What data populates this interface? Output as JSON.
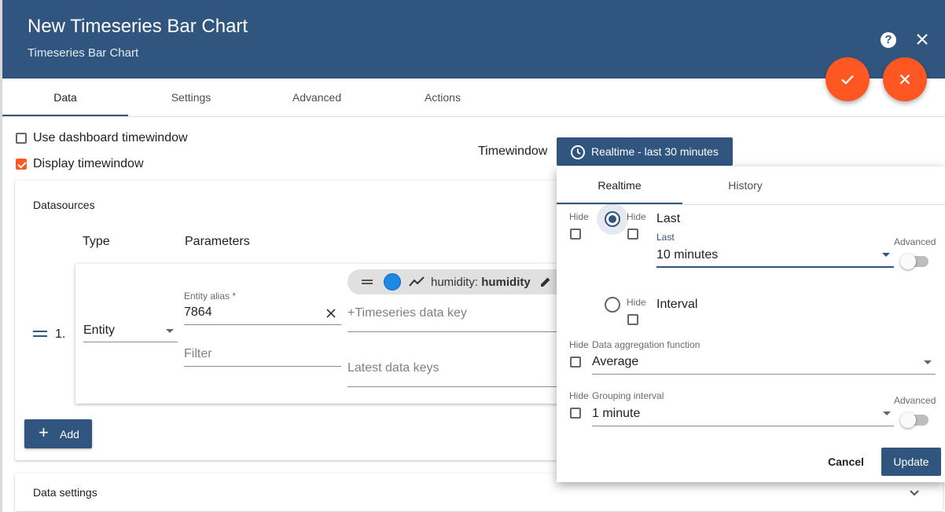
{
  "dialog": {
    "title": "New Timeseries Bar Chart",
    "subtitle": "Timeseries Bar Chart"
  },
  "tabs": [
    "Data",
    "Settings",
    "Advanced",
    "Actions"
  ],
  "options": {
    "use_dashboard_timewindow": "Use dashboard timewindow",
    "display_timewindow": "Display timewindow"
  },
  "timewindow": {
    "label": "Timewindow",
    "button": "Realtime - last 30 minutes"
  },
  "datasources": {
    "title": "Datasources",
    "col_type": "Type",
    "col_params": "Parameters",
    "row": {
      "index": "1.",
      "type_value": "Entity",
      "entity_alias_label": "Entity alias *",
      "entity_alias_value": "7864",
      "filter_placeholder": "Filter",
      "chip_label": "humidity: ",
      "chip_bold": "humidity",
      "timeseries_placeholder": "+Timeseries data key",
      "latest_placeholder": "Latest data keys"
    },
    "add_label": "Add"
  },
  "data_settings": "Data settings",
  "popup": {
    "tabs": [
      "Realtime",
      "History"
    ],
    "hide": "Hide",
    "last_label": "Last",
    "last_field_label": "Last",
    "last_value": "10 minutes",
    "advanced": "Advanced",
    "interval_label": "Interval",
    "agg_label": "Data aggregation function",
    "agg_value": "Average",
    "group_label": "Grouping interval",
    "group_value": "1 minute",
    "cancel": "Cancel",
    "update": "Update"
  },
  "colors": {
    "primary": "#305680",
    "accent": "#ff5722",
    "chip_dot": "#1e88e5"
  }
}
